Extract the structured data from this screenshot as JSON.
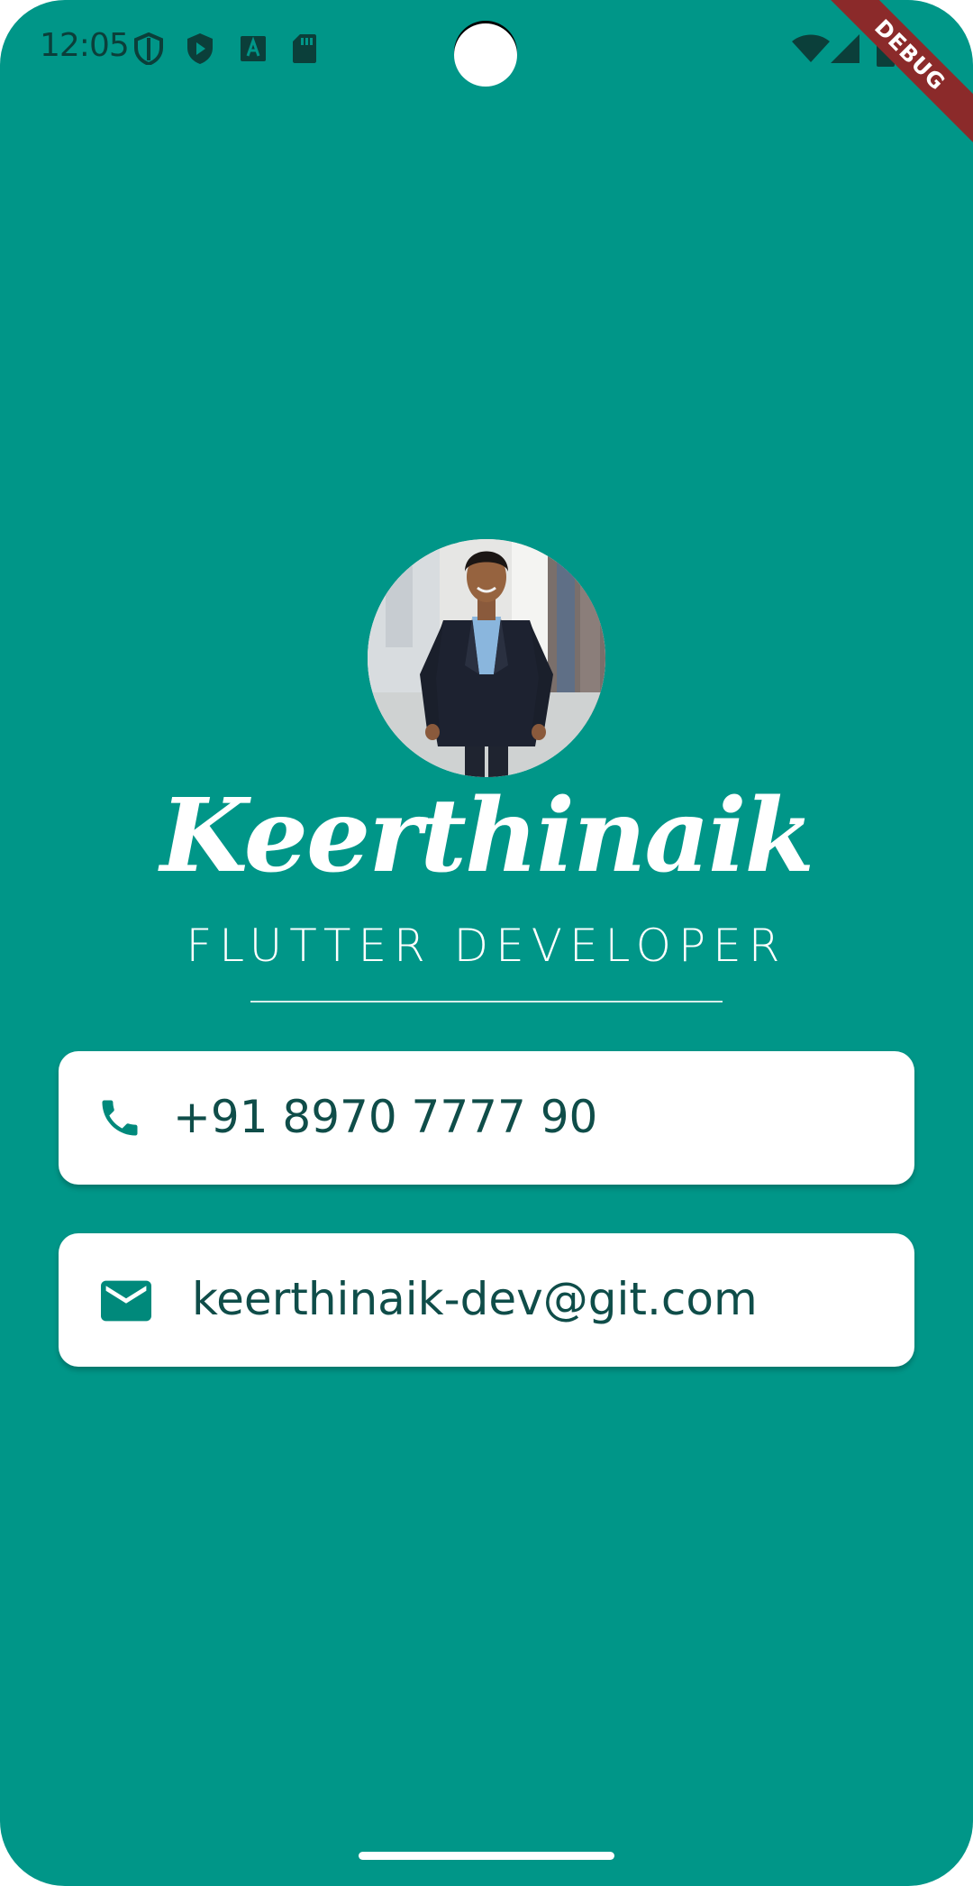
{
  "status_bar": {
    "time": "12:05",
    "left_icons": [
      "shield-outline-icon",
      "play-protect-icon",
      "android-a-icon",
      "sd-card-icon"
    ],
    "right_icons": [
      "wifi-icon",
      "cellular-signal-icon",
      "battery-icon"
    ],
    "icon_color": "#0b3f3a"
  },
  "debug_banner": {
    "label": "DEBUG",
    "color": "#8b2a2a"
  },
  "profile": {
    "avatar_icon": "profile-photo",
    "name": "Keerthinaik",
    "title": "FLUTTER DEVELOPER"
  },
  "contacts": {
    "phone": {
      "icon": "phone-icon",
      "value": "+91 8970 7777 90"
    },
    "email": {
      "icon": "mail-icon",
      "value": "keerthinaik-dev@git.com"
    }
  },
  "colors": {
    "background": "#009688",
    "card": "#ffffff",
    "card_text": "#0f4d49",
    "icon": "#00897b"
  }
}
